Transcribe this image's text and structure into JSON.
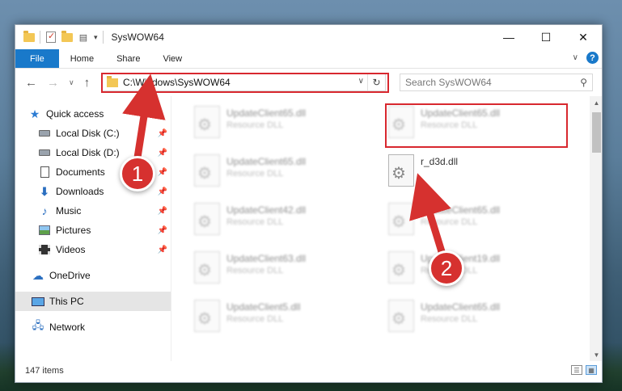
{
  "window": {
    "title": "SysWOW64"
  },
  "ribbon": {
    "tabs": [
      "File",
      "Home",
      "Share",
      "View"
    ]
  },
  "address": {
    "path": "C:\\Windows\\SysWOW64"
  },
  "search": {
    "placeholder": "Search SysWOW64"
  },
  "sidebar": {
    "items": [
      {
        "label": "Quick access",
        "icon": "star-icon"
      },
      {
        "label": "Local Disk (C:)",
        "icon": "disk-icon"
      },
      {
        "label": "Local Disk (D:)",
        "icon": "disk-icon"
      },
      {
        "label": "Documents",
        "icon": "documents-icon"
      },
      {
        "label": "Downloads",
        "icon": "downloads-icon"
      },
      {
        "label": "Music",
        "icon": "music-icon"
      },
      {
        "label": "Pictures",
        "icon": "pictures-icon"
      },
      {
        "label": "Videos",
        "icon": "videos-icon"
      },
      {
        "label": "OneDrive",
        "icon": "cloud-icon"
      },
      {
        "label": "This PC",
        "icon": "computer-icon"
      },
      {
        "label": "Network",
        "icon": "network-icon"
      }
    ]
  },
  "files": [
    {
      "name": "UpdateClient65.dll",
      "type": "Resource DLL"
    },
    {
      "name": "UpdateClient65.dll",
      "type": "Resource DLL"
    },
    {
      "name": "UpdateClient65.dll",
      "type": "Resource DLL"
    },
    {
      "name": "r_d3d.dll",
      "type": ""
    },
    {
      "name": "UpdateClient42.dll",
      "type": "Resource DLL"
    },
    {
      "name": "UpdateClient65.dll",
      "type": "Resource DLL"
    },
    {
      "name": "UpdateClient63.dll",
      "type": "Resource DLL"
    },
    {
      "name": "UpdateClient19.dll",
      "type": "Resource DLL"
    },
    {
      "name": "UpdateClient5.dll",
      "type": "Resource DLL"
    },
    {
      "name": "UpdateClient65.dll",
      "type": "Resource DLL"
    }
  ],
  "status": {
    "item_count": "147 items"
  },
  "annotations": {
    "step1": "1",
    "step2": "2"
  },
  "colors": {
    "accent": "#1979ca",
    "highlight": "#d8282f",
    "badge": "#d6312f"
  }
}
